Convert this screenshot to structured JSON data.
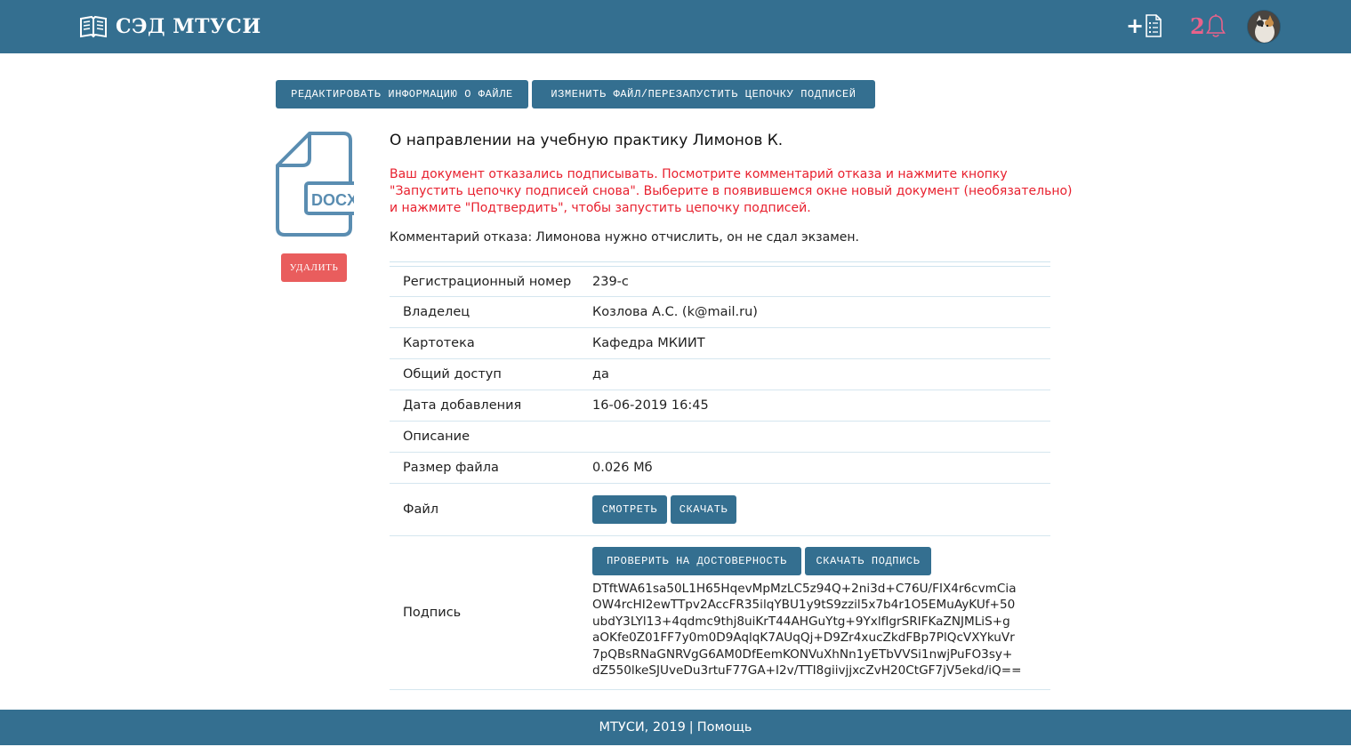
{
  "header": {
    "title": "СЭД МТУСИ",
    "notification_count": "2",
    "colors": {
      "bar": "#346f90",
      "badge": "#e8628a"
    }
  },
  "toolbar": {
    "edit_label": "РЕДАКТИРОВАТЬ ИНФОРМАЦИЮ О ФАЙЛЕ",
    "change_label": "ИЗМЕНИТЬ ФАЙЛ/ПЕРЕЗАПУСТИТЬ ЦЕПОЧКУ ПОДПИСЕЙ"
  },
  "file_icon": {
    "ext": "DOCX"
  },
  "delete_label": "УДАЛИТЬ",
  "document": {
    "title": "О направлении на учебную практику Лимонов К.",
    "warning_lines": [
      "Ваш документ отказались подписывать. Посмотрите комментарий отказа и нажмите кнопку",
      "\"Запустить цепочку подписей снова\". Выберите в появившемся окне новый документ (необязательно)",
      "и нажмите \"Подтвердить\", чтобы запустить цепочку подписей."
    ],
    "comment_label": "Комментарий отказа:",
    "comment_text": "Лимонова нужно отчислить, он не сдал экзамен."
  },
  "info": {
    "rows": [
      {
        "key": "Регистрационный номер",
        "value": "239-с"
      },
      {
        "key": "Владелец",
        "value": "Козлова А.С. (k@mail.ru)"
      },
      {
        "key": "Картотека",
        "value": "Кафедра МКИИТ"
      },
      {
        "key": "Общий доступ",
        "value": "да"
      },
      {
        "key": "Дата добавления",
        "value": "16-06-2019 16:45"
      },
      {
        "key": "Описание",
        "value": ""
      },
      {
        "key": "Размер файла",
        "value": "0.026 Мб"
      }
    ],
    "file_label": "Файл",
    "view_label": "СМОТРЕТЬ",
    "download_label": "СКАЧАТЬ",
    "signature_label": "Подпись",
    "verify_label": "ПРОВЕРИТЬ НА ДОСТОВЕРНОСТЬ",
    "download_sig_label": "СКАЧАТЬ ПОДПИСЬ",
    "signature_lines": [
      "DTftWA61sa50L1H65HqevMpMzLC5z94Q+2ni3d+C76U/FIX4r6cvmCia",
      "OW4rcHI2ewTTpv2AccFR35ilqYBU1y9tS9zzil5x7b4r1O5EMuAyKUf+50",
      "ubdY3LYl13+4qdmc9thj8uiKrT44AHGuYtg+9YxlfIgrSRIFKaZNJMLiS+g",
      "aOKfe0Z01FF7y0m0D9AqlqK7AUqQj+D9Zr4xucZkdFBp7PlQcVXYkuVr",
      "7pQBsRNaGNRVgG6AM0DfEemKONVuXhNn1yETbVVSi1nwjPuFO3sy+",
      "dZ550lkeSJUveDu3rtuF77GA+I2v/TTI8giivjjxcZvH20CtGF7jV5ekd/iQ=="
    ]
  },
  "footer": {
    "copyright": "МТУСИ, 2019",
    "separator": "|",
    "help_label": "Помощь"
  }
}
